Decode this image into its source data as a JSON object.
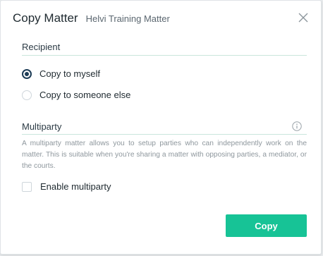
{
  "dialog": {
    "title": "Copy Matter",
    "subtitle": "Helvi Training Matter",
    "close_icon": "close-icon"
  },
  "recipient": {
    "heading": "Recipient",
    "options": [
      {
        "label": "Copy to myself",
        "checked": true
      },
      {
        "label": "Copy to someone else",
        "checked": false
      }
    ]
  },
  "multiparty": {
    "heading": "Multiparty",
    "info_icon": "info-icon",
    "description": "A multiparty matter allows you to setup parties who can independently work on the matter. This is suitable when you're sharing a matter with opposing parties, a mediator, or the courts.",
    "checkbox_label": "Enable multiparty",
    "checkbox_checked": false
  },
  "footer": {
    "copy_label": "Copy"
  },
  "colors": {
    "accent": "#17c396",
    "radio_selected": "#1d3c56",
    "divider": "#c9e6dc"
  }
}
